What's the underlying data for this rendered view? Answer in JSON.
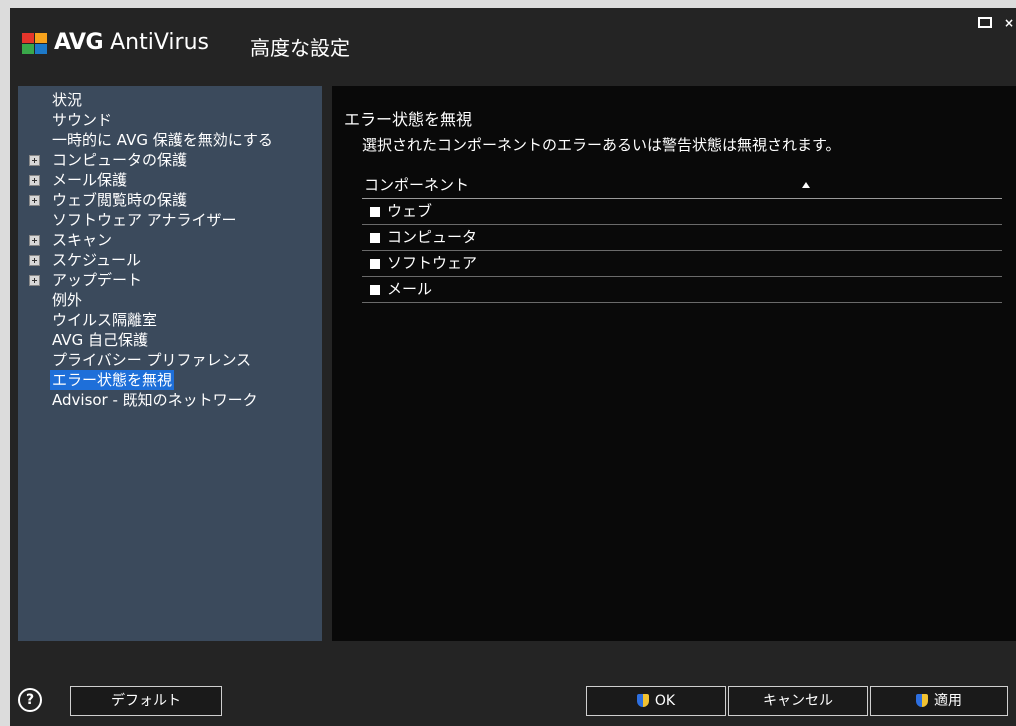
{
  "titlebar": {
    "brand": "AVG",
    "product": "AntiVirus",
    "title": "高度な設定"
  },
  "sidebar": {
    "items": [
      {
        "label": "状況",
        "expandable": false,
        "selected": false
      },
      {
        "label": "サウンド",
        "expandable": false,
        "selected": false
      },
      {
        "label": "一時的に AVG 保護を無効にする",
        "expandable": false,
        "selected": false
      },
      {
        "label": "コンピュータの保護",
        "expandable": true,
        "selected": false
      },
      {
        "label": "メール保護",
        "expandable": true,
        "selected": false
      },
      {
        "label": "ウェブ閲覧時の保護",
        "expandable": true,
        "selected": false
      },
      {
        "label": "ソフトウェア アナライザー",
        "expandable": false,
        "selected": false
      },
      {
        "label": "スキャン",
        "expandable": true,
        "selected": false
      },
      {
        "label": "スケジュール",
        "expandable": true,
        "selected": false
      },
      {
        "label": "アップデート",
        "expandable": true,
        "selected": false
      },
      {
        "label": "例外",
        "expandable": false,
        "selected": false
      },
      {
        "label": "ウイルス隔離室",
        "expandable": false,
        "selected": false
      },
      {
        "label": "AVG 自己保護",
        "expandable": false,
        "selected": false
      },
      {
        "label": "プライバシー プリファレンス",
        "expandable": false,
        "selected": false
      },
      {
        "label": "エラー状態を無視",
        "expandable": false,
        "selected": true
      },
      {
        "label": "Advisor - 既知のネットワーク",
        "expandable": false,
        "selected": false
      }
    ]
  },
  "main": {
    "title": "エラー状態を無視",
    "description": "選択されたコンポーネントのエラーあるいは警告状態は無視されます。",
    "table": {
      "header": "コンポーネント",
      "rows": [
        {
          "label": "ウェブ",
          "checked": false
        },
        {
          "label": "コンピュータ",
          "checked": false
        },
        {
          "label": "ソフトウェア",
          "checked": false
        },
        {
          "label": "メール",
          "checked": false
        }
      ]
    }
  },
  "footer": {
    "help_symbol": "?",
    "default_label": "デフォルト",
    "ok_label": "OK",
    "cancel_label": "キャンセル",
    "apply_label": "適用"
  },
  "colors": {
    "window_bg": "#242424",
    "sidebar_bg": "#3b4a5c",
    "content_bg": "#090909",
    "selection": "#1e6fd9"
  }
}
